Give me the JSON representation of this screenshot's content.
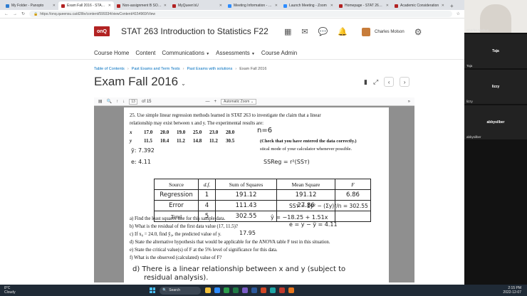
{
  "browser": {
    "tabs": [
      {
        "title": "My Folder - Panopto",
        "color": "#2e7dd1",
        "active": false
      },
      {
        "title": "Exam Fall 2016 - STAT 263",
        "color": "#b22222",
        "active": true
      },
      {
        "title": "Non-assignment B SOLUTI",
        "color": "#b22222",
        "active": false
      },
      {
        "title": "MyQueen'sU",
        "color": "#b22222",
        "active": false
      },
      {
        "title": "Meeting Information - Zoo",
        "color": "#2d8cff",
        "active": false
      },
      {
        "title": "Launch Meeting - Zoom",
        "color": "#2d8cff",
        "active": false
      },
      {
        "title": "Homepage - STAT 263 Int",
        "color": "#b22222",
        "active": false
      },
      {
        "title": "Academic Consideration",
        "color": "#b22222",
        "active": false
      }
    ],
    "url": "https://onq.queensu.ca/d2l/le/content/599334/viewContent/4154969/View"
  },
  "header": {
    "logo": "onQ",
    "course_title": "STAT 263 Introduction to Statistics F22",
    "user_name": "Charles Molson"
  },
  "nav": {
    "items": [
      "Course Home",
      "Content",
      "Communications",
      "Assessments",
      "Course Admin"
    ]
  },
  "breadcrumbs": [
    "Table of Contents",
    "Past Exams and Term Tests",
    "Past Exams with solutions",
    "Exam Fall 2016"
  ],
  "page": {
    "title": "Exam Fall 2016"
  },
  "pdf_toolbar": {
    "page_number": "13",
    "page_total": "of 15",
    "zoom": "Automatic Zoom"
  },
  "exam": {
    "q25_line1": "25.  Use simple linear regression methods learned in STAT 263 to investigate the claim that a linear",
    "q25_line2": "relationship may exist between x and y. The experimental results are:",
    "x_label": "x",
    "x_values": [
      "17.0",
      "20.0",
      "19.0",
      "25.0",
      "23.0",
      "28.0"
    ],
    "y_label": "y",
    "y_values": [
      "11.5",
      "10.4",
      "11.2",
      "14.8",
      "11.2",
      "30.5"
    ],
    "check_note": "(Check that you have entered the data correctly.)",
    "calc_note": "stical mode of your calculator whenever possible.",
    "table_headers": [
      "Source",
      "d.f.",
      "Sum of Squares",
      "Mean Square",
      "F"
    ],
    "table_rows": [
      {
        "source": "Regression",
        "df": "1",
        "ss": "191.12",
        "ms": "191.12",
        "f": "6.86"
      },
      {
        "source": "Error",
        "df": "4",
        "ss": "111.43",
        "ms": "27.86",
        "f": ""
      },
      {
        "source": "Total",
        "df": "5",
        "ss": "302.55",
        "ms": "",
        "f": ""
      }
    ],
    "qa": "a) Find the least squares line for this sample data.",
    "qb": "b) What is the residual of the first data value (17, 11.5)?",
    "qc": "c) If x₀ = 24.0, find ŷ₀, the predicted value of y.",
    "qd": "d) State the alternative hypothesis that would be applicable for the ANOVA table F test in this situation.",
    "qe": "e) State the critical value(s) of F at the 5% level of significance for this data.",
    "qf": "f) What is the observed (calculated) value of F?",
    "hw_n": "n=6",
    "hw_ybar": "ȳ:  7.392",
    "hw_e": "e:  4.11",
    "hw_ssreg": "SSReg = r²(SSᴛ)",
    "hw_sst": "SSᴛ = Σy² − (Σy)²/n = 302.55",
    "hw_a": "ŷ = −18.25 + 1.51x",
    "hw_b": "e = y − ŷ = 4.11",
    "hw_c": "17.95",
    "hw_d1": "d) There is a linear relationship between x and y (subject to",
    "hw_d2": "residual analysis)."
  },
  "side_panel": {
    "self_name": "Charles Molson",
    "participants": [
      "Taja",
      "lizzy",
      "abbysilber"
    ]
  },
  "taskbar": {
    "temp": "8°C",
    "weather": "Cloudy",
    "search": "Search",
    "time": "2:15 PM",
    "date": "2022-12-07"
  }
}
